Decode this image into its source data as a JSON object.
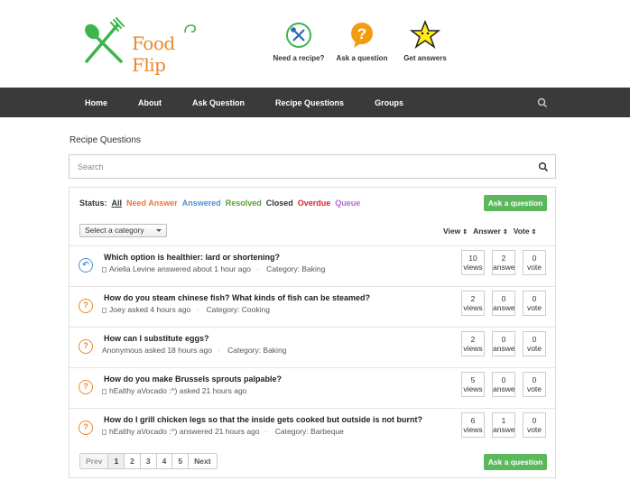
{
  "brand": {
    "name": "Food Flip",
    "accent": "#e8892c",
    "green": "#3cb54a"
  },
  "header_links": [
    {
      "label": "Need a recipe?",
      "icon": "fork-spoon-icon"
    },
    {
      "label": "Ask a question",
      "icon": "question-bubble-icon"
    },
    {
      "label": "Get answers",
      "icon": "star-icon"
    }
  ],
  "nav": {
    "items": [
      "Home",
      "About",
      "Ask Question",
      "Recipe Questions",
      "Groups"
    ],
    "search_icon": "search-icon"
  },
  "page_title": "Recipe Questions",
  "search": {
    "placeholder": "Search"
  },
  "status": {
    "label": "Status:",
    "filters": [
      {
        "label": "All",
        "color": "#333333"
      },
      {
        "label": "Need Answer",
        "color": "#f0743e"
      },
      {
        "label": "Answered",
        "color": "#4a90d9"
      },
      {
        "label": "Resolved",
        "color": "#5a9e2f"
      },
      {
        "label": "Closed",
        "color": "#333333"
      },
      {
        "label": "Overdue",
        "color": "#d9252b"
      },
      {
        "label": "Queue",
        "color": "#b26bd6"
      }
    ]
  },
  "ask_button": "Ask a question",
  "category_select": "Select a category",
  "sort": {
    "view": "View",
    "answer": "Answer",
    "vote": "Vote"
  },
  "questions": [
    {
      "title": "Which option is healthier: lard or shortening?",
      "author": "Ariella Levine",
      "action": "answered",
      "time": "about 1 hour ago",
      "category_label": "Category:",
      "category": "Baking",
      "views": "10",
      "views_label": "views",
      "answers": "2",
      "answers_label": "answers",
      "votes": "0",
      "votes_label": "vote",
      "state": "answered"
    },
    {
      "title": "How do you steam chinese fish? What kinds of fish can be steamed?",
      "author": "Joey",
      "action": "asked",
      "time": "4 hours ago",
      "category_label": "Category:",
      "category": "Cooking",
      "views": "2",
      "views_label": "views",
      "answers": "0",
      "answers_label": "answer",
      "votes": "0",
      "votes_label": "vote",
      "state": "open"
    },
    {
      "title": "How can I substitute eggs?",
      "author": "Anonymous",
      "action": "asked",
      "time": "18 hours ago",
      "category_label": "Category:",
      "category": "Baking",
      "views": "2",
      "views_label": "views",
      "answers": "0",
      "answers_label": "answer",
      "votes": "0",
      "votes_label": "vote",
      "state": "open"
    },
    {
      "title": "How do you make Brussels sprouts palpable?",
      "author": "hEalthy aVocado :^)",
      "action": "asked",
      "time": "21 hours ago",
      "category_label": "",
      "category": "",
      "views": "5",
      "views_label": "views",
      "answers": "0",
      "answers_label": "answer",
      "votes": "0",
      "votes_label": "vote",
      "state": "open"
    },
    {
      "title": "How do I grill chicken legs so that the inside gets cooked but outside is not burnt?",
      "author": "hEalthy aVocado :^)",
      "action": "answered",
      "time": "21 hours ago",
      "category_label": "Category:",
      "category": "Barbeque",
      "views": "6",
      "views_label": "views",
      "answers": "1",
      "answers_label": "answer",
      "votes": "0",
      "votes_label": "vote",
      "state": "open"
    }
  ],
  "pagination": {
    "prev": "Prev",
    "pages": [
      "1",
      "2",
      "3",
      "4",
      "5"
    ],
    "next": "Next",
    "current": "1"
  }
}
